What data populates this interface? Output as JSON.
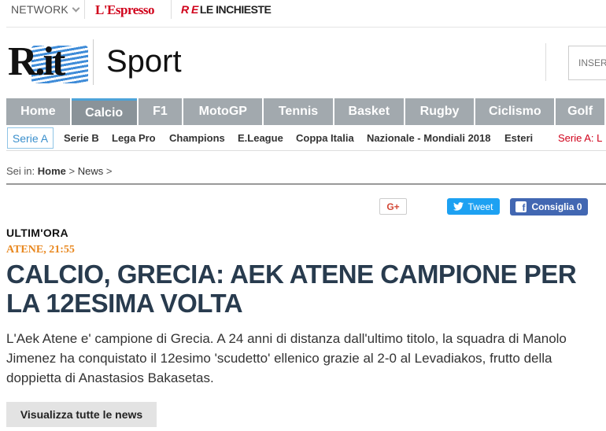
{
  "topbar": {
    "network_label": "NETWORK",
    "espresso_label": "L'Espresso",
    "inchieste_prefix": "R E",
    "inchieste_label": "LE INCHIESTE"
  },
  "header": {
    "logo_text": "R.it",
    "section_title": "Sport",
    "search_placeholder": "INSERISCI"
  },
  "main_nav": {
    "items": [
      {
        "label": "Home"
      },
      {
        "label": "Calcio"
      },
      {
        "label": "F1"
      },
      {
        "label": "MotoGP"
      },
      {
        "label": "Tennis"
      },
      {
        "label": "Basket"
      },
      {
        "label": "Rugby"
      },
      {
        "label": "Ciclismo"
      },
      {
        "label": "Golf"
      }
    ],
    "active": "Calcio"
  },
  "sub_nav": {
    "active_label": "Serie A",
    "items": [
      {
        "label": "Serie B"
      },
      {
        "label": "Lega Pro"
      },
      {
        "label": "Champions"
      },
      {
        "label": "E.League"
      },
      {
        "label": "Coppa Italia"
      },
      {
        "label": "Nazionale - Mondiali 2018"
      },
      {
        "label": "Esteri"
      }
    ],
    "red_label": "Serie A:  L"
  },
  "breadcrumb": {
    "prefix": "Sei in:",
    "home": "Home",
    "sep1": ">",
    "news": "News",
    "sep2": ">"
  },
  "share": {
    "gplus_label": "G+",
    "tweet_label": "Tweet",
    "consiglia_label": "Consiglia 0"
  },
  "article": {
    "kicker": "ULTIM'ORA",
    "dateline": "ATENE, 21:55",
    "headline": "CALCIO, GRECIA: AEK ATENE CAMPIONE PER LA 12ESIMA VOLTA",
    "body": "L'Aek Atene e' campione di Grecia. A 24 anni di distanza dall'ultimo titolo, la squadra di Manolo Jimenez ha conquistato il 12esimo 'scudetto' ellenico grazie al 2-0 al Levadiakos, frutto della doppietta di Anastasios Bakasetas."
  },
  "all_news_button": "Visualizza tutte le news",
  "colors": {
    "nav_bg": "#a2a9ae",
    "nav_active_accent": "#4da3d8",
    "headline": "#283b4e",
    "dateline": "#e8871e",
    "brand_red": "#d0021b",
    "twitter": "#1da1f2",
    "facebook": "#4267b2"
  }
}
